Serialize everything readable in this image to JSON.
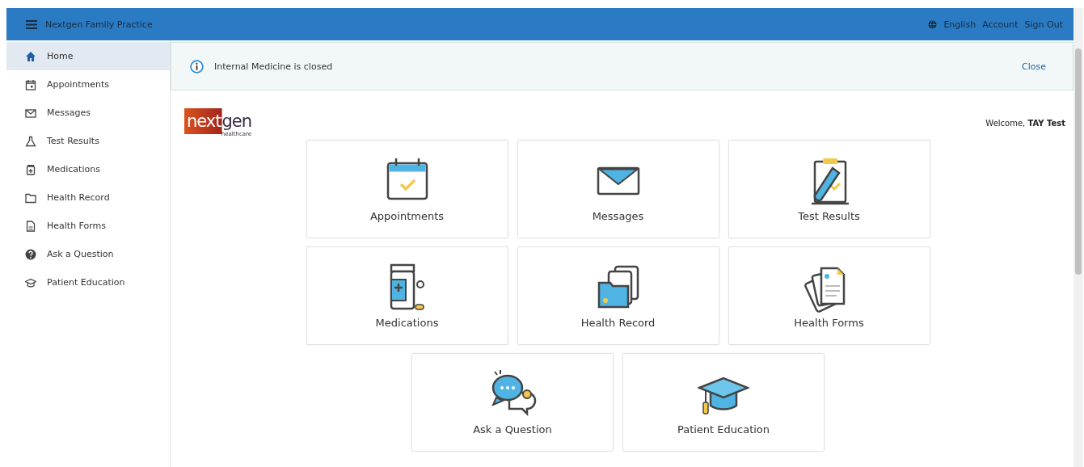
{
  "header": {
    "title": "Nextgen Family Practice",
    "links": [
      "English",
      "Account",
      "Sign Out"
    ]
  },
  "sidebar": {
    "items": [
      {
        "label": "Home",
        "selected": true
      },
      {
        "label": "Appointments",
        "selected": false
      },
      {
        "label": "Messages",
        "selected": false
      },
      {
        "label": "Test Results",
        "selected": false
      },
      {
        "label": "Medications",
        "selected": false
      },
      {
        "label": "Health Record",
        "selected": false
      },
      {
        "label": "Health Forms",
        "selected": false
      },
      {
        "label": "Ask a Question",
        "selected": false
      },
      {
        "label": "Patient Education",
        "selected": false
      }
    ]
  },
  "banner": {
    "message": "Internal Medicine is closed",
    "close": "Close"
  },
  "logo": {
    "part1": "next",
    "part2": "gen",
    "tagline": "healthcare"
  },
  "welcome": "Welcome, **TAY Test**",
  "tiles": [
    {
      "label": "Appointments"
    },
    {
      "label": "Messages"
    },
    {
      "label": "Test Results"
    },
    {
      "label": "Medications"
    },
    {
      "label": "Health Record"
    },
    {
      "label": "Health Forms"
    },
    {
      "label": "Ask a Question"
    },
    {
      "label": "Patient Education"
    }
  ]
}
